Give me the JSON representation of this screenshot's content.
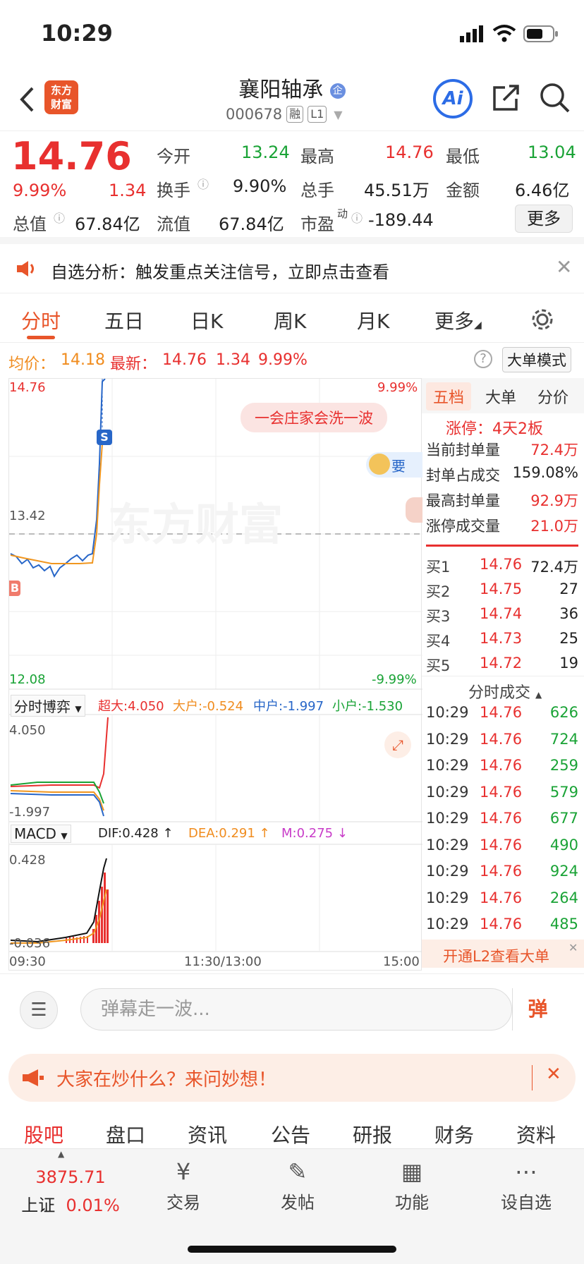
{
  "status": {
    "time": "10:29"
  },
  "header": {
    "logo_text": "东方财富",
    "stock_name": "襄阳轴承",
    "stock_code": "000678",
    "tag1": "融",
    "tag2": "L1",
    "ai_label": "Ai"
  },
  "quote": {
    "price": "14.76",
    "change_pct": "9.99%",
    "change": "1.34",
    "open_label": "今开",
    "open": "13.24",
    "high_label": "最高",
    "high": "14.76",
    "low_label": "最低",
    "low": "13.04",
    "turnover_label": "换手",
    "turnover": "9.90%",
    "volume_label": "总手",
    "volume": "45.51万",
    "amount_label": "金额",
    "amount": "6.46亿",
    "mktcap_label": "总值",
    "mktcap": "67.84亿",
    "float_label": "流值",
    "float": "67.84亿",
    "pe_label": "市盈",
    "pe_sup": "动",
    "pe": "-189.44",
    "more": "更多"
  },
  "alert": {
    "text": "自选分析：触发重点关注信号，立即点击查看"
  },
  "tabs": [
    "分时",
    "五日",
    "日K",
    "周K",
    "月K",
    "更多"
  ],
  "avg_row": {
    "avg_label": "均价：",
    "avg": "14.18",
    "latest_label": "最新：",
    "latest": "14.76",
    "chg": "1.34",
    "pct": "9.99%",
    "mode_btn": "大单模式"
  },
  "chart": {
    "y_top": "14.76",
    "y_mid": "13.42",
    "y_bot": "12.08",
    "pct_top": "9.99%",
    "pct_bot": "-9.99%",
    "bubble": "一会庄家会洗一波",
    "watermark": "东方财富",
    "float_tag": "要",
    "marker_s": "S",
    "marker_b": "B",
    "fund_select": "分时博弈",
    "fund_super": "超大:4.050",
    "fund_big": "大户:-0.524",
    "fund_mid": "中户:-1.997",
    "fund_small": "小户:-1.530",
    "fund_top": "4.050",
    "fund_bot": "-1.997",
    "macd_select": "MACD",
    "dif": "DIF:0.428 ↑",
    "dea": "DEA:0.291 ↑",
    "m": "M:0.275 ↓",
    "macd_top": "0.428",
    "macd_bot": "-0.036",
    "t_start": "09:30",
    "t_mid": "11:30/13:00",
    "t_end": "15:00"
  },
  "right": {
    "tabs": [
      "五档",
      "大单",
      "分价"
    ],
    "limit_status": "涨停：4天2板",
    "seal_rows": [
      {
        "label": "当前封单量",
        "value": "72.4万"
      },
      {
        "label": "封单占成交",
        "value": "159.08%"
      },
      {
        "label": "最高封单量",
        "value": "92.9万"
      },
      {
        "label": "涨停成交量",
        "value": "21.0万"
      }
    ],
    "bids": [
      {
        "label": "买1",
        "price": "14.76",
        "vol": "72.4万"
      },
      {
        "label": "买2",
        "price": "14.75",
        "vol": "27"
      },
      {
        "label": "买3",
        "price": "14.74",
        "vol": "36"
      },
      {
        "label": "买4",
        "price": "14.73",
        "vol": "25"
      },
      {
        "label": "买5",
        "price": "14.72",
        "vol": "19"
      }
    ],
    "trades_title": "分时成交",
    "trades": [
      {
        "time": "10:29",
        "price": "14.76",
        "vol": "626"
      },
      {
        "time": "10:29",
        "price": "14.76",
        "vol": "724"
      },
      {
        "time": "10:29",
        "price": "14.76",
        "vol": "259"
      },
      {
        "time": "10:29",
        "price": "14.76",
        "vol": "579"
      },
      {
        "time": "10:29",
        "price": "14.76",
        "vol": "677"
      },
      {
        "time": "10:29",
        "price": "14.76",
        "vol": "490"
      },
      {
        "time": "10:29",
        "price": "14.76",
        "vol": "924"
      },
      {
        "time": "10:29",
        "price": "14.76",
        "vol": "264"
      },
      {
        "time": "10:29",
        "price": "14.76",
        "vol": "485"
      }
    ],
    "l2_promo": "开通L2查看大单"
  },
  "danmu": {
    "placeholder": "弹幕走一波...",
    "send": "弹"
  },
  "banner": {
    "text": "大家在炒什么？来问妙想！"
  },
  "subnav": [
    "股吧",
    "盘口",
    "资讯",
    "公告",
    "研报",
    "财务",
    "资料"
  ],
  "bottom": {
    "index_value": "3875.71",
    "index_name": "上证",
    "index_pct": "0.01%",
    "items": [
      "交易",
      "发帖",
      "功能",
      "设自选"
    ]
  }
}
